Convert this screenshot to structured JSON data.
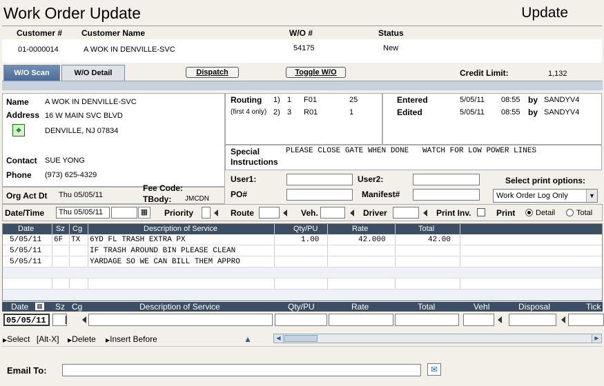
{
  "window": {
    "title": "Work Order Update",
    "mode": "Update"
  },
  "header": {
    "col_customer_no": "Customer #",
    "col_customer_name": "Customer Name",
    "col_wo": "W/O #",
    "col_status": "Status",
    "customer_no": "01-0000014",
    "customer_name": "A WOK IN DENVILLE-SVC",
    "wo": "54175",
    "status": "New"
  },
  "tabs": {
    "scan": "W/O Scan",
    "detail": "W/O Detail"
  },
  "toolbar": {
    "dispatch": "Dispatch",
    "toggle": "Toggle W/O",
    "credit_label": "Credit Limit:",
    "credit_value": "1,132"
  },
  "customer": {
    "name_label": "Name",
    "name": "A WOK IN DENVILLE-SVC",
    "address_label": "Address",
    "address1": "16 W MAIN SVC BLVD",
    "address2": "DENVILLE, NJ 07834",
    "contact_label": "Contact",
    "contact": "SUE YONG",
    "phone_label": "Phone",
    "phone": "(973) 625-4329"
  },
  "routing": {
    "label": "Routing",
    "sub": "(first 4 only)",
    "r1_idx": "1)",
    "r1_a": "1",
    "r1_b": "F01",
    "r1_c": "25",
    "r2_idx": "2)",
    "r2_a": "3",
    "r2_b": "R01",
    "r2_c": "1"
  },
  "audit": {
    "entered_label": "Entered",
    "entered_date": "5/05/11",
    "entered_time": "08:55",
    "by": "by",
    "entered_by": "SANDYV4",
    "edited_label": "Edited",
    "edited_date": "5/05/11",
    "edited_time": "08:55",
    "edited_by": "SANDYV4"
  },
  "special": {
    "label1": "Special",
    "label2": "Instructions",
    "text": "PLEASE CLOSE GATE WHEN DONE   WATCH FOR LOW POWER LINES"
  },
  "users": {
    "user1": "User1:",
    "user2": "User2:",
    "po": "PO#",
    "manifest": "Manifest#"
  },
  "print_options": {
    "label": "Select print options:",
    "selected": "Work Order Log Only"
  },
  "org": {
    "label": "Org Act Dt",
    "value": "Thu 05/05/11",
    "fee_label": "Fee Code:",
    "tbody_label": "TBody:",
    "tbody_value": "JMCDN"
  },
  "row_fields": {
    "datetime_label": "Date/Time",
    "datetime_value": "Thu 05/05/11",
    "priority": "Priority",
    "route": "Route",
    "veh": "Veh.",
    "driver": "Driver",
    "print_inv": "Print Inv.",
    "print": "Print",
    "detail": "Detail",
    "total": "Total"
  },
  "grid": {
    "headers": {
      "date": "Date",
      "sz": "Sz",
      "cg": "Cg",
      "desc": "Description of Service",
      "qty": "Qty/PU",
      "rate": "Rate",
      "total": "Total"
    },
    "rows": [
      {
        "date": "5/05/11",
        "sz": "6F",
        "cg": "TX",
        "desc": "6YD FL TRASH EXTRA PX",
        "qty": "1.00",
        "rate": "42.000",
        "total": "42.00"
      },
      {
        "date": "5/05/11",
        "sz": "",
        "cg": "",
        "desc": "IF TRASH AROUND BIN PLEASE CLEAN",
        "qty": "",
        "rate": "",
        "total": ""
      },
      {
        "date": "5/05/11",
        "sz": "",
        "cg": "",
        "desc": "YARDAGE SO WE CAN BILL THEM APPRO",
        "qty": "",
        "rate": "",
        "total": ""
      }
    ]
  },
  "entry": {
    "headers": {
      "date": "Date",
      "sz": "Sz",
      "cg": "Cg",
      "desc": "Description of Service",
      "qty": "Qty/PU",
      "rate": "Rate",
      "total": "Total",
      "vehl": "Vehl",
      "disposal": "Disposal",
      "tick": "Tick"
    },
    "date_value": "05/05/11"
  },
  "actions": {
    "select": "Select",
    "select_key": "[Alt-X]",
    "delete": "Delete",
    "insert": "Insert Before"
  },
  "email": {
    "label": "Email To:",
    "value": ""
  }
}
